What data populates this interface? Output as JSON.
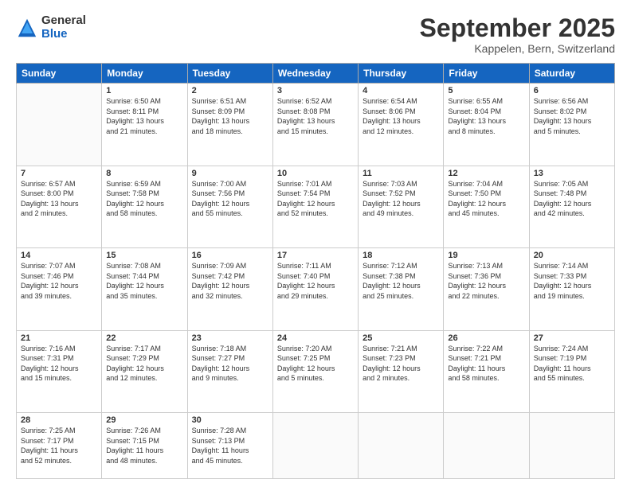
{
  "logo": {
    "general": "General",
    "blue": "Blue"
  },
  "title": "September 2025",
  "subtitle": "Kappelen, Bern, Switzerland",
  "headers": [
    "Sunday",
    "Monday",
    "Tuesday",
    "Wednesday",
    "Thursday",
    "Friday",
    "Saturday"
  ],
  "weeks": [
    [
      {
        "day": "",
        "info": ""
      },
      {
        "day": "1",
        "info": "Sunrise: 6:50 AM\nSunset: 8:11 PM\nDaylight: 13 hours\nand 21 minutes."
      },
      {
        "day": "2",
        "info": "Sunrise: 6:51 AM\nSunset: 8:09 PM\nDaylight: 13 hours\nand 18 minutes."
      },
      {
        "day": "3",
        "info": "Sunrise: 6:52 AM\nSunset: 8:08 PM\nDaylight: 13 hours\nand 15 minutes."
      },
      {
        "day": "4",
        "info": "Sunrise: 6:54 AM\nSunset: 8:06 PM\nDaylight: 13 hours\nand 12 minutes."
      },
      {
        "day": "5",
        "info": "Sunrise: 6:55 AM\nSunset: 8:04 PM\nDaylight: 13 hours\nand 8 minutes."
      },
      {
        "day": "6",
        "info": "Sunrise: 6:56 AM\nSunset: 8:02 PM\nDaylight: 13 hours\nand 5 minutes."
      }
    ],
    [
      {
        "day": "7",
        "info": "Sunrise: 6:57 AM\nSunset: 8:00 PM\nDaylight: 13 hours\nand 2 minutes."
      },
      {
        "day": "8",
        "info": "Sunrise: 6:59 AM\nSunset: 7:58 PM\nDaylight: 12 hours\nand 58 minutes."
      },
      {
        "day": "9",
        "info": "Sunrise: 7:00 AM\nSunset: 7:56 PM\nDaylight: 12 hours\nand 55 minutes."
      },
      {
        "day": "10",
        "info": "Sunrise: 7:01 AM\nSunset: 7:54 PM\nDaylight: 12 hours\nand 52 minutes."
      },
      {
        "day": "11",
        "info": "Sunrise: 7:03 AM\nSunset: 7:52 PM\nDaylight: 12 hours\nand 49 minutes."
      },
      {
        "day": "12",
        "info": "Sunrise: 7:04 AM\nSunset: 7:50 PM\nDaylight: 12 hours\nand 45 minutes."
      },
      {
        "day": "13",
        "info": "Sunrise: 7:05 AM\nSunset: 7:48 PM\nDaylight: 12 hours\nand 42 minutes."
      }
    ],
    [
      {
        "day": "14",
        "info": "Sunrise: 7:07 AM\nSunset: 7:46 PM\nDaylight: 12 hours\nand 39 minutes."
      },
      {
        "day": "15",
        "info": "Sunrise: 7:08 AM\nSunset: 7:44 PM\nDaylight: 12 hours\nand 35 minutes."
      },
      {
        "day": "16",
        "info": "Sunrise: 7:09 AM\nSunset: 7:42 PM\nDaylight: 12 hours\nand 32 minutes."
      },
      {
        "day": "17",
        "info": "Sunrise: 7:11 AM\nSunset: 7:40 PM\nDaylight: 12 hours\nand 29 minutes."
      },
      {
        "day": "18",
        "info": "Sunrise: 7:12 AM\nSunset: 7:38 PM\nDaylight: 12 hours\nand 25 minutes."
      },
      {
        "day": "19",
        "info": "Sunrise: 7:13 AM\nSunset: 7:36 PM\nDaylight: 12 hours\nand 22 minutes."
      },
      {
        "day": "20",
        "info": "Sunrise: 7:14 AM\nSunset: 7:33 PM\nDaylight: 12 hours\nand 19 minutes."
      }
    ],
    [
      {
        "day": "21",
        "info": "Sunrise: 7:16 AM\nSunset: 7:31 PM\nDaylight: 12 hours\nand 15 minutes."
      },
      {
        "day": "22",
        "info": "Sunrise: 7:17 AM\nSunset: 7:29 PM\nDaylight: 12 hours\nand 12 minutes."
      },
      {
        "day": "23",
        "info": "Sunrise: 7:18 AM\nSunset: 7:27 PM\nDaylight: 12 hours\nand 9 minutes."
      },
      {
        "day": "24",
        "info": "Sunrise: 7:20 AM\nSunset: 7:25 PM\nDaylight: 12 hours\nand 5 minutes."
      },
      {
        "day": "25",
        "info": "Sunrise: 7:21 AM\nSunset: 7:23 PM\nDaylight: 12 hours\nand 2 minutes."
      },
      {
        "day": "26",
        "info": "Sunrise: 7:22 AM\nSunset: 7:21 PM\nDaylight: 11 hours\nand 58 minutes."
      },
      {
        "day": "27",
        "info": "Sunrise: 7:24 AM\nSunset: 7:19 PM\nDaylight: 11 hours\nand 55 minutes."
      }
    ],
    [
      {
        "day": "28",
        "info": "Sunrise: 7:25 AM\nSunset: 7:17 PM\nDaylight: 11 hours\nand 52 minutes."
      },
      {
        "day": "29",
        "info": "Sunrise: 7:26 AM\nSunset: 7:15 PM\nDaylight: 11 hours\nand 48 minutes."
      },
      {
        "day": "30",
        "info": "Sunrise: 7:28 AM\nSunset: 7:13 PM\nDaylight: 11 hours\nand 45 minutes."
      },
      {
        "day": "",
        "info": ""
      },
      {
        "day": "",
        "info": ""
      },
      {
        "day": "",
        "info": ""
      },
      {
        "day": "",
        "info": ""
      }
    ]
  ]
}
